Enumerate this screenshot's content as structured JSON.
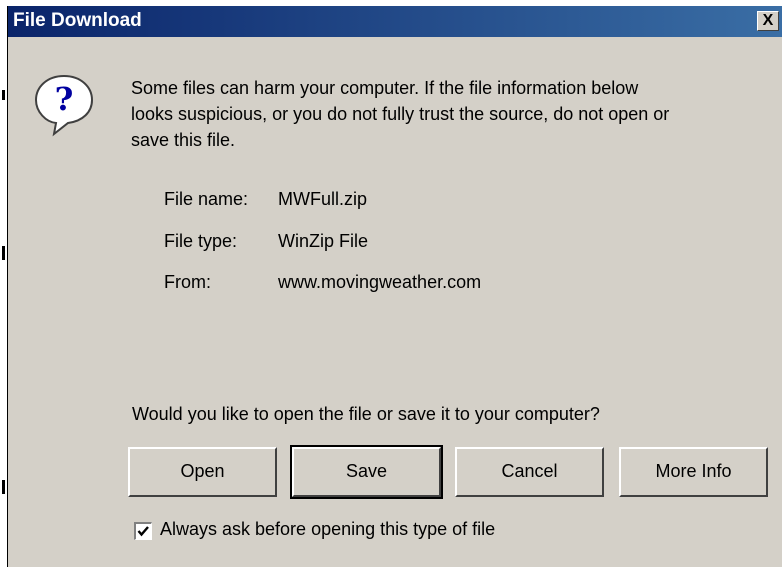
{
  "window": {
    "title": "File Download",
    "close_label": "X"
  },
  "icon": "question-icon",
  "message": {
    "line1": "Some files can harm your computer. If the file information below",
    "line2": "looks suspicious, or you do not fully trust the source, do not open or",
    "line3": "save this file."
  },
  "file_info": {
    "name_label": "File name:",
    "name_value": "MWFull.zip",
    "type_label": "File type:",
    "type_value": "WinZip File",
    "from_label": "From:",
    "from_value": "www.movingweather.com"
  },
  "question": "Would you like to open the file or save it to your computer?",
  "buttons": {
    "open": "Open",
    "save": "Save",
    "cancel": "Cancel",
    "more_info": "More Info"
  },
  "checkbox": {
    "label": "Always ask before opening this type of file",
    "checked": true
  },
  "colors": {
    "titlebar": "#0a246a",
    "face": "#d4d0c8"
  }
}
